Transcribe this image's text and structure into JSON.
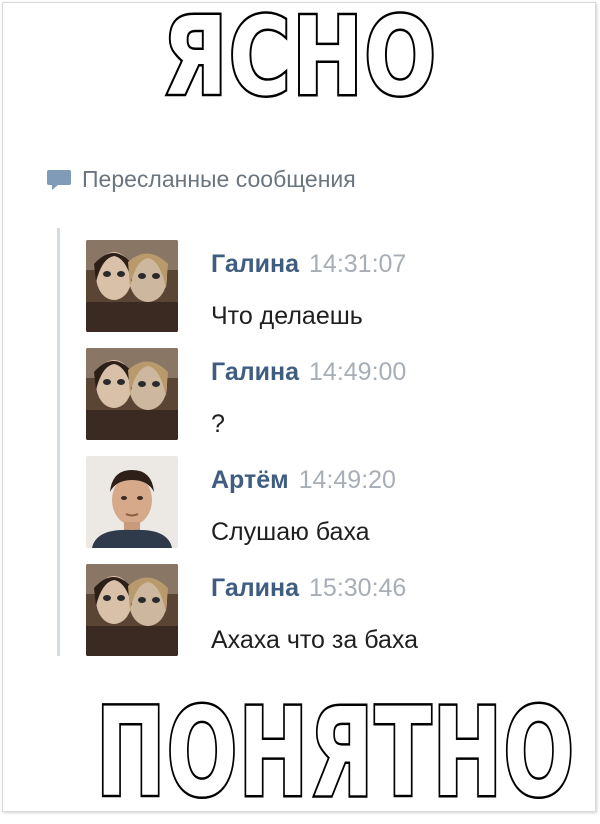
{
  "meme": {
    "top": "ЯСНО",
    "bottom": "ПОНЯТНО"
  },
  "forwarded": {
    "title": "Пересланные сообщения",
    "icon": "speech-bubble-icon"
  },
  "messages": [
    {
      "name": "Галина",
      "time": "14:31:07",
      "text": "Что делаешь",
      "avatar": "two-women-photo"
    },
    {
      "name": "Галина",
      "time": "14:49:00",
      "text": "?",
      "avatar": "two-women-photo"
    },
    {
      "name": "Артём",
      "time": "14:49:20",
      "text": "Слушаю баха",
      "avatar": "young-man-photo"
    },
    {
      "name": "Галина",
      "time": "15:30:46",
      "text": "Ахаха что за баха",
      "avatar": "two-women-photo"
    }
  ],
  "colors": {
    "name": "#3e5d80",
    "time": "#a7aeb6",
    "thread_line": "#d3dbe3",
    "header_text": "#6b7580"
  }
}
